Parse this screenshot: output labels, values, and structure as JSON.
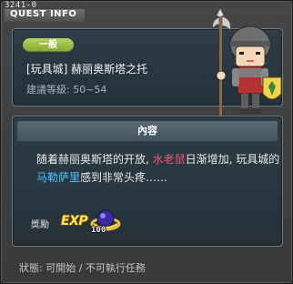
{
  "window": {
    "quest_id": "3241-0",
    "header_label": "QUEST INFO"
  },
  "quest": {
    "category": "一般",
    "title": "[玩具城] 赫丽奥斯塔之托",
    "level_range": "建議等級: 50~54"
  },
  "content": {
    "header": "內容",
    "desc_part1": "随着赫丽奥斯塔的开放, ",
    "desc_highlight_red": "水老鼠",
    "desc_part2": "日渐增加, 玩具城的",
    "desc_highlight_blue": "马勒萨里",
    "desc_part3": "感到非常头疼……"
  },
  "reward": {
    "label": "獎勵",
    "exp_icon_text": "EXP",
    "item_icon": "purple-orb-ring-icon",
    "item_count": "100"
  },
  "status": {
    "text": "狀態:  可開始  / 不可執行任務"
  },
  "colors": {
    "badge_green": "#a3c44a",
    "highlight_red": "#ff4a6e",
    "highlight_blue": "#4cc2ff"
  }
}
